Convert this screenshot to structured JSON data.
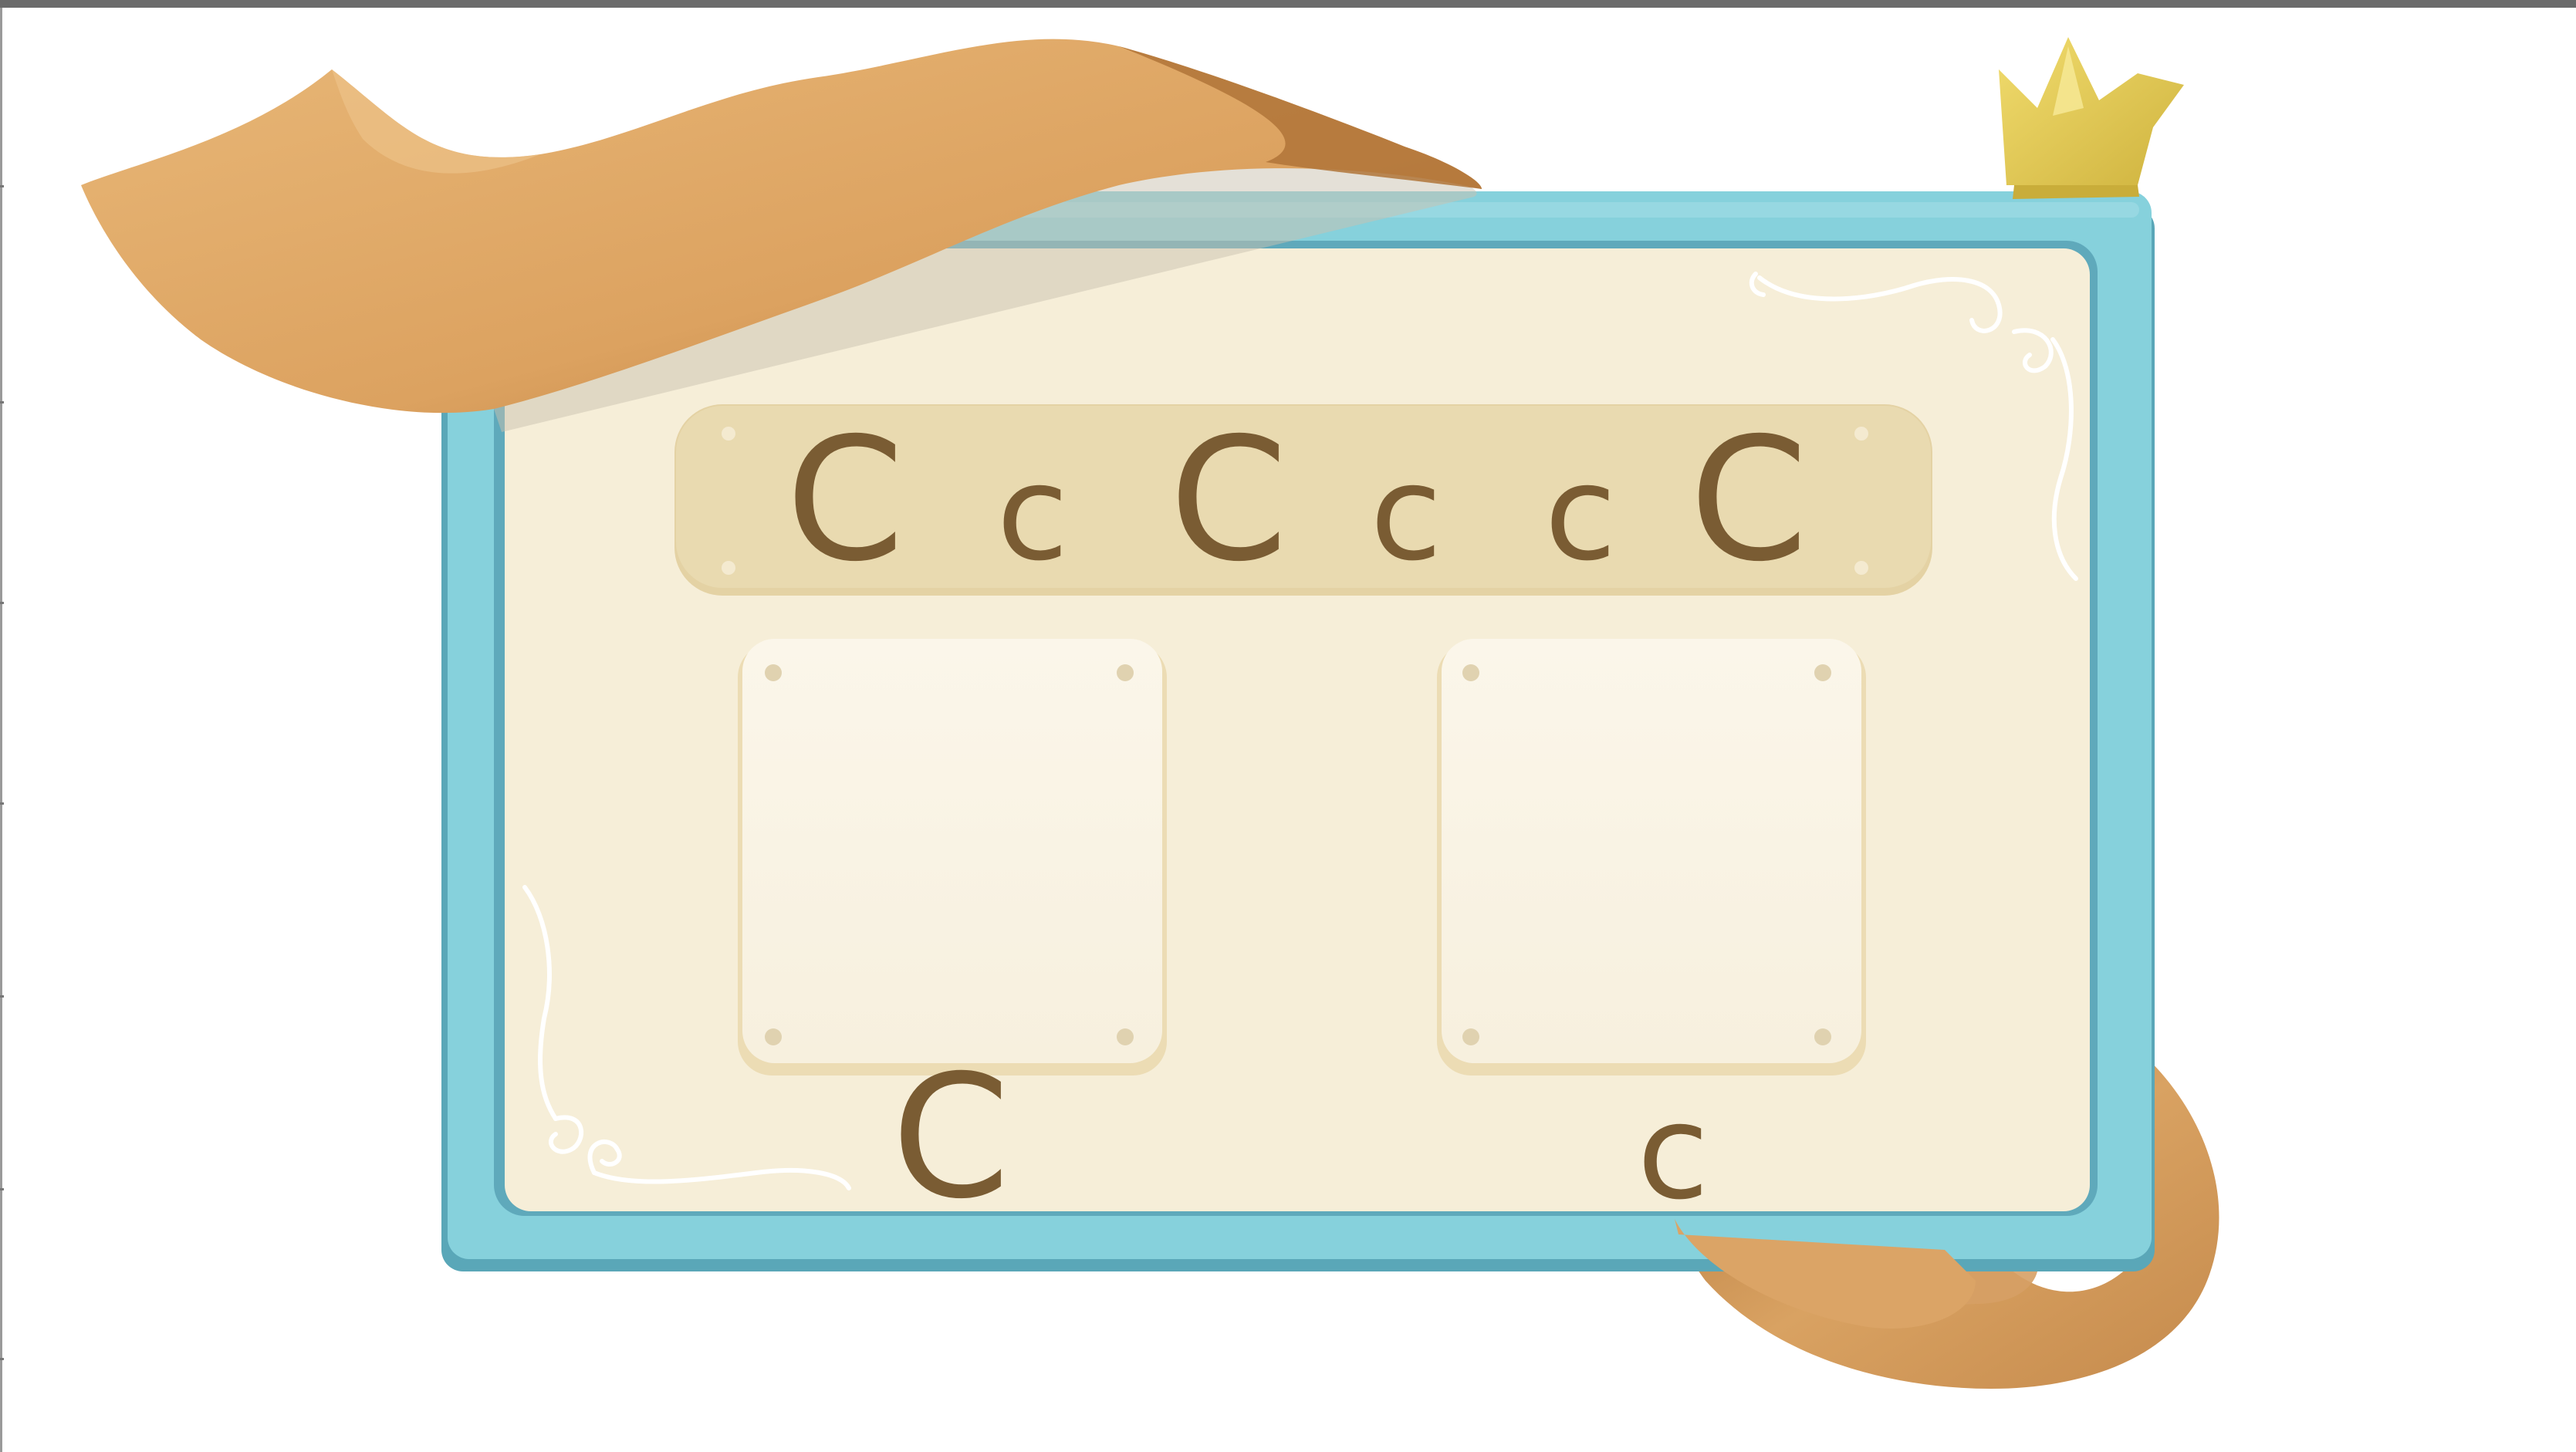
{
  "game": {
    "letter_bank": [
      "C",
      "c",
      "C",
      "c",
      "c",
      "C"
    ],
    "bins": [
      {
        "label": "C"
      },
      {
        "label": "c"
      }
    ]
  },
  "colors": {
    "frame": "#86d1dc",
    "board": "#f6eed8",
    "letter_strip": "#e9dab0",
    "letter_ink": "#7a5c33",
    "ribbon": "#dfa866",
    "crown": "#e6cc52"
  },
  "icons": [
    "ribbon-banner",
    "crown-icon",
    "swirl-ornament"
  ]
}
